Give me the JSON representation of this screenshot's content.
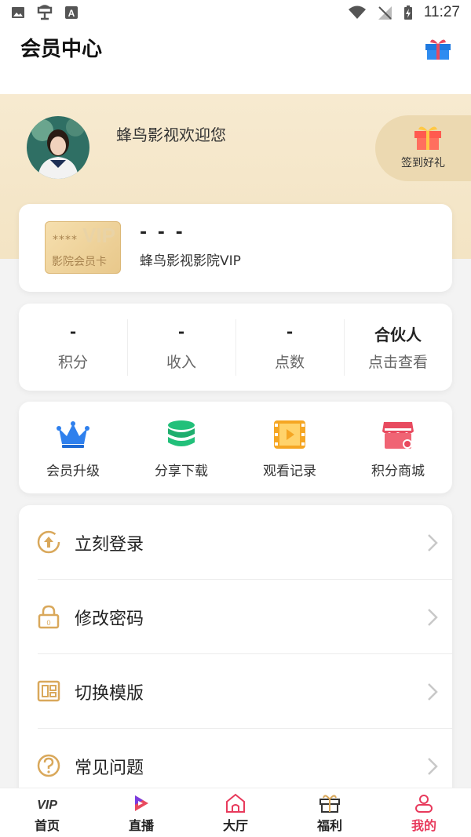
{
  "status_bar": {
    "time": "11:27"
  },
  "header": {
    "title": "会员中心"
  },
  "hero": {
    "welcome": "蜂鸟影视欢迎您",
    "signin_label": "签到好礼"
  },
  "vip_card": {
    "stars": "****",
    "card_word": "VIP",
    "card_label": "影院会员卡",
    "name_placeholder": "- - -",
    "level": "蜂鸟影视影院VIP"
  },
  "stats": [
    {
      "value": "-",
      "label": "积分"
    },
    {
      "value": "-",
      "label": "收入"
    },
    {
      "value": "-",
      "label": "点数"
    },
    {
      "value": "合伙人",
      "label": "点击查看"
    }
  ],
  "shortcuts": [
    {
      "label": "会员升级",
      "icon": "crown-icon",
      "color": "#2f80ed"
    },
    {
      "label": "分享下载",
      "icon": "database-icon",
      "color": "#22c07a"
    },
    {
      "label": "观看记录",
      "icon": "film-icon",
      "color": "#f5a623"
    },
    {
      "label": "积分商城",
      "icon": "shop-icon",
      "color": "#e84a5f"
    }
  ],
  "menu": [
    {
      "label": "立刻登录",
      "icon": "upload-circle-icon"
    },
    {
      "label": "修改密码",
      "icon": "lock-icon"
    },
    {
      "label": "切换模版",
      "icon": "template-icon"
    },
    {
      "label": "常见问题",
      "icon": "question-icon"
    }
  ],
  "tabs": [
    {
      "label": "首页",
      "icon": "vip-icon",
      "active": false
    },
    {
      "label": "直播",
      "icon": "live-icon",
      "active": false
    },
    {
      "label": "大厅",
      "icon": "home-icon",
      "active": false
    },
    {
      "label": "福利",
      "icon": "gift-icon",
      "active": false
    },
    {
      "label": "我的",
      "icon": "user-icon",
      "active": true
    }
  ],
  "colors": {
    "accent": "#e83a5c",
    "gold": "#d9a85b",
    "hero_bg": "#f5e6c8"
  }
}
